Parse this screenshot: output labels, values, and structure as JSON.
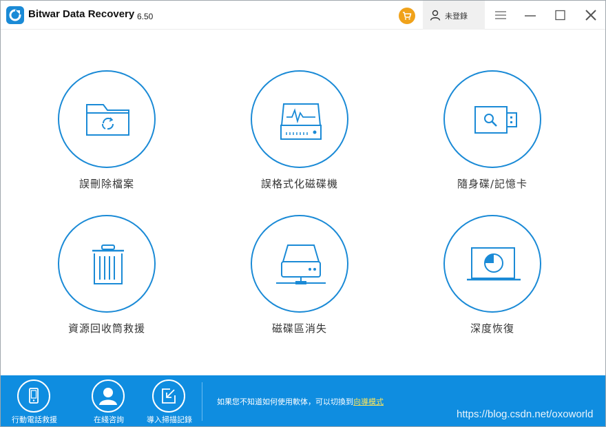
{
  "titlebar": {
    "app_name": "Bitwar Data Recovery",
    "version": "6.50",
    "login_label": "未登錄",
    "icons": [
      "app-logo-icon",
      "cart-icon",
      "user-icon",
      "menu-icon",
      "minimize-icon",
      "maximize-icon",
      "close-icon"
    ]
  },
  "tiles": [
    {
      "label": "誤刪除檔案",
      "icon": "folder-recycle-icon"
    },
    {
      "label": "誤格式化磁碟機",
      "icon": "hard-drive-icon"
    },
    {
      "label": "隨身碟/記憶卡",
      "icon": "usb-drive-icon"
    },
    {
      "label": "資源回收筒救援",
      "icon": "recycle-bin-icon"
    },
    {
      "label": "磁碟區消失",
      "icon": "network-drive-icon"
    },
    {
      "label": "深度恢復",
      "icon": "laptop-scan-icon"
    }
  ],
  "bottombar": {
    "items": [
      {
        "label": "行動電話救援",
        "icon": "mobile-phone-icon"
      },
      {
        "label": "在綫咨詢",
        "icon": "support-person-icon"
      },
      {
        "label": "導入掃描記錄",
        "icon": "import-icon"
      }
    ],
    "hint_text": "如果您不知道如何使用軟体，可以切換到",
    "hint_link": "向導模式",
    "watermark": "https://blog.csdn.net/oxoworld"
  },
  "colors": {
    "accent": "#1a8ad6",
    "bottom_bar": "#0f8de0",
    "cart": "#f0a21a",
    "link": "#ffe65a"
  }
}
